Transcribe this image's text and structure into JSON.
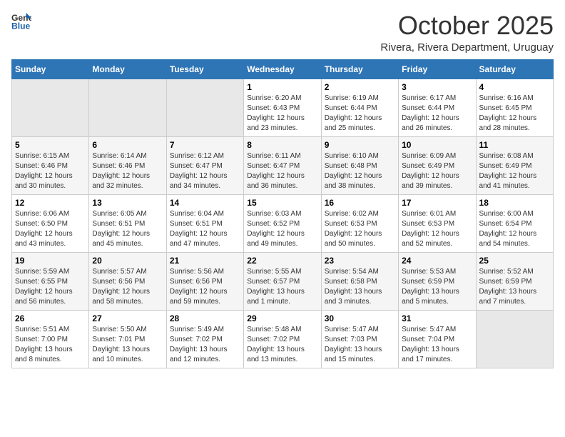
{
  "logo": {
    "line1": "General",
    "line2": "Blue"
  },
  "title": "October 2025",
  "subtitle": "Rivera, Rivera Department, Uruguay",
  "days_header": [
    "Sunday",
    "Monday",
    "Tuesday",
    "Wednesday",
    "Thursday",
    "Friday",
    "Saturday"
  ],
  "weeks": [
    [
      {
        "num": "",
        "info": ""
      },
      {
        "num": "",
        "info": ""
      },
      {
        "num": "",
        "info": ""
      },
      {
        "num": "1",
        "info": "Sunrise: 6:20 AM\nSunset: 6:43 PM\nDaylight: 12 hours\nand 23 minutes."
      },
      {
        "num": "2",
        "info": "Sunrise: 6:19 AM\nSunset: 6:44 PM\nDaylight: 12 hours\nand 25 minutes."
      },
      {
        "num": "3",
        "info": "Sunrise: 6:17 AM\nSunset: 6:44 PM\nDaylight: 12 hours\nand 26 minutes."
      },
      {
        "num": "4",
        "info": "Sunrise: 6:16 AM\nSunset: 6:45 PM\nDaylight: 12 hours\nand 28 minutes."
      }
    ],
    [
      {
        "num": "5",
        "info": "Sunrise: 6:15 AM\nSunset: 6:46 PM\nDaylight: 12 hours\nand 30 minutes."
      },
      {
        "num": "6",
        "info": "Sunrise: 6:14 AM\nSunset: 6:46 PM\nDaylight: 12 hours\nand 32 minutes."
      },
      {
        "num": "7",
        "info": "Sunrise: 6:12 AM\nSunset: 6:47 PM\nDaylight: 12 hours\nand 34 minutes."
      },
      {
        "num": "8",
        "info": "Sunrise: 6:11 AM\nSunset: 6:47 PM\nDaylight: 12 hours\nand 36 minutes."
      },
      {
        "num": "9",
        "info": "Sunrise: 6:10 AM\nSunset: 6:48 PM\nDaylight: 12 hours\nand 38 minutes."
      },
      {
        "num": "10",
        "info": "Sunrise: 6:09 AM\nSunset: 6:49 PM\nDaylight: 12 hours\nand 39 minutes."
      },
      {
        "num": "11",
        "info": "Sunrise: 6:08 AM\nSunset: 6:49 PM\nDaylight: 12 hours\nand 41 minutes."
      }
    ],
    [
      {
        "num": "12",
        "info": "Sunrise: 6:06 AM\nSunset: 6:50 PM\nDaylight: 12 hours\nand 43 minutes."
      },
      {
        "num": "13",
        "info": "Sunrise: 6:05 AM\nSunset: 6:51 PM\nDaylight: 12 hours\nand 45 minutes."
      },
      {
        "num": "14",
        "info": "Sunrise: 6:04 AM\nSunset: 6:51 PM\nDaylight: 12 hours\nand 47 minutes."
      },
      {
        "num": "15",
        "info": "Sunrise: 6:03 AM\nSunset: 6:52 PM\nDaylight: 12 hours\nand 49 minutes."
      },
      {
        "num": "16",
        "info": "Sunrise: 6:02 AM\nSunset: 6:53 PM\nDaylight: 12 hours\nand 50 minutes."
      },
      {
        "num": "17",
        "info": "Sunrise: 6:01 AM\nSunset: 6:53 PM\nDaylight: 12 hours\nand 52 minutes."
      },
      {
        "num": "18",
        "info": "Sunrise: 6:00 AM\nSunset: 6:54 PM\nDaylight: 12 hours\nand 54 minutes."
      }
    ],
    [
      {
        "num": "19",
        "info": "Sunrise: 5:59 AM\nSunset: 6:55 PM\nDaylight: 12 hours\nand 56 minutes."
      },
      {
        "num": "20",
        "info": "Sunrise: 5:57 AM\nSunset: 6:56 PM\nDaylight: 12 hours\nand 58 minutes."
      },
      {
        "num": "21",
        "info": "Sunrise: 5:56 AM\nSunset: 6:56 PM\nDaylight: 12 hours\nand 59 minutes."
      },
      {
        "num": "22",
        "info": "Sunrise: 5:55 AM\nSunset: 6:57 PM\nDaylight: 13 hours\nand 1 minute."
      },
      {
        "num": "23",
        "info": "Sunrise: 5:54 AM\nSunset: 6:58 PM\nDaylight: 13 hours\nand 3 minutes."
      },
      {
        "num": "24",
        "info": "Sunrise: 5:53 AM\nSunset: 6:59 PM\nDaylight: 13 hours\nand 5 minutes."
      },
      {
        "num": "25",
        "info": "Sunrise: 5:52 AM\nSunset: 6:59 PM\nDaylight: 13 hours\nand 7 minutes."
      }
    ],
    [
      {
        "num": "26",
        "info": "Sunrise: 5:51 AM\nSunset: 7:00 PM\nDaylight: 13 hours\nand 8 minutes."
      },
      {
        "num": "27",
        "info": "Sunrise: 5:50 AM\nSunset: 7:01 PM\nDaylight: 13 hours\nand 10 minutes."
      },
      {
        "num": "28",
        "info": "Sunrise: 5:49 AM\nSunset: 7:02 PM\nDaylight: 13 hours\nand 12 minutes."
      },
      {
        "num": "29",
        "info": "Sunrise: 5:48 AM\nSunset: 7:02 PM\nDaylight: 13 hours\nand 13 minutes."
      },
      {
        "num": "30",
        "info": "Sunrise: 5:47 AM\nSunset: 7:03 PM\nDaylight: 13 hours\nand 15 minutes."
      },
      {
        "num": "31",
        "info": "Sunrise: 5:47 AM\nSunset: 7:04 PM\nDaylight: 13 hours\nand 17 minutes."
      },
      {
        "num": "",
        "info": ""
      }
    ]
  ]
}
